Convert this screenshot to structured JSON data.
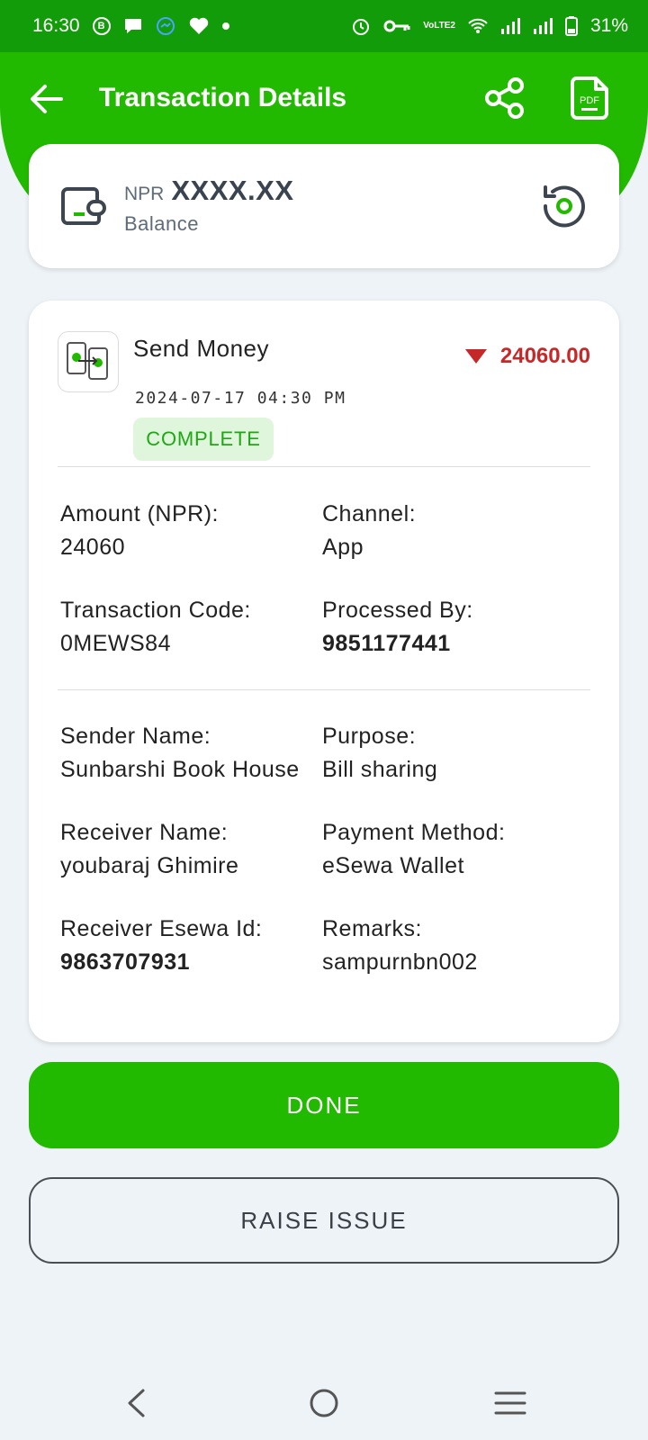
{
  "status_bar": {
    "time": "16:30",
    "battery": "31%",
    "network": "VoLTE2",
    "icons": [
      "b-icon",
      "chat-icon",
      "messenger-icon",
      "heart-icon",
      "dot-icon",
      "alarm-icon",
      "key-icon",
      "volte-icon",
      "wifi-icon",
      "signal-icon",
      "signal-icon",
      "battery-icon"
    ]
  },
  "header": {
    "title": "Transaction Details",
    "back_icon": "arrow-left-icon",
    "share_icon": "share-icon",
    "pdf_label": "PDF",
    "background_color": "#22ba00"
  },
  "balance": {
    "currency": "NPR",
    "amount": "XXXX.XX",
    "label": "Balance",
    "refresh_icon": "refresh-icon"
  },
  "transaction": {
    "type": "Send Money",
    "amount": "24060.00",
    "direction_icon": "down-triangle-icon",
    "date": "2024-07-17 04:30 PM",
    "status": "COMPLETE",
    "details": [
      {
        "label": "Amount (NPR):",
        "value": "24060"
      },
      {
        "label": "Channel:",
        "value": "App"
      },
      {
        "label": "Transaction Code:",
        "value": "0MEWS84"
      },
      {
        "label": "Processed By:",
        "value": "9851177441"
      },
      {
        "label": "Sender Name:",
        "value": "Sunbarshi Book House"
      },
      {
        "label": "Purpose:",
        "value": "Bill sharing"
      },
      {
        "label": "Receiver Name:",
        "value": "youbaraj Ghimire"
      },
      {
        "label": "Payment Method:",
        "value": "eSewa Wallet"
      },
      {
        "label": "Receiver Esewa Id:",
        "value": "9863707931"
      },
      {
        "label": "Remarks:",
        "value": "sampurnbn002"
      }
    ]
  },
  "buttons": {
    "done": "DONE",
    "raise_issue": "RAISE ISSUE"
  },
  "colors": {
    "accent": "#22ba00",
    "debit": "#c62828",
    "status_bg": "#dff5dc",
    "status_text": "#1fa814"
  }
}
